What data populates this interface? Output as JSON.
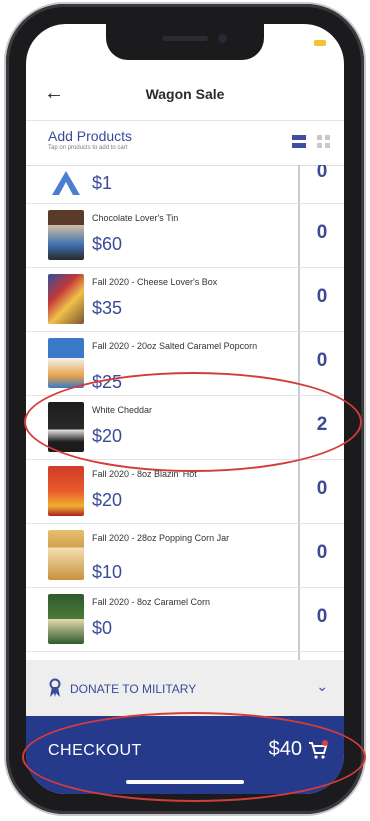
{
  "header": {
    "back_icon": "back-arrow-icon",
    "title": "Wagon Sale"
  },
  "add_products": {
    "title": "Add Products",
    "hint": "Tap on products to add to cart",
    "view_toggle": [
      "list-view-icon",
      "grid-view-icon"
    ]
  },
  "products": [
    {
      "name": "",
      "price": "$1",
      "qty": "0"
    },
    {
      "name": "Chocolate Lover's Tin",
      "price": "$60",
      "qty": "0"
    },
    {
      "name": "Fall 2020 - Cheese Lover's Box",
      "price": "$35",
      "qty": "0"
    },
    {
      "name": "Fall 2020 - 20oz Salted Caramel Popcorn",
      "price": "$25",
      "qty": "0"
    },
    {
      "name": "White Cheddar",
      "price": "$20",
      "qty": "2"
    },
    {
      "name": "Fall 2020 - 8oz Blazin' Hot",
      "price": "$20",
      "qty": "0"
    },
    {
      "name": "Fall 2020 - 28oz Popping Corn Jar",
      "price": "$10",
      "qty": "0"
    },
    {
      "name": "Fall 2020 - 8oz Caramel Corn",
      "price": "$0",
      "qty": "0"
    }
  ],
  "donate": {
    "label": "DONATE TO MILITARY",
    "icon": "ribbon-icon",
    "chevron": "chevron-down-icon"
  },
  "checkout": {
    "label": "CHECKOUT",
    "total": "$40",
    "icon": "cart-icon"
  },
  "colors": {
    "brand": "#253a8a",
    "accent": "#3b4a98",
    "annotation": "#d43c3c"
  }
}
